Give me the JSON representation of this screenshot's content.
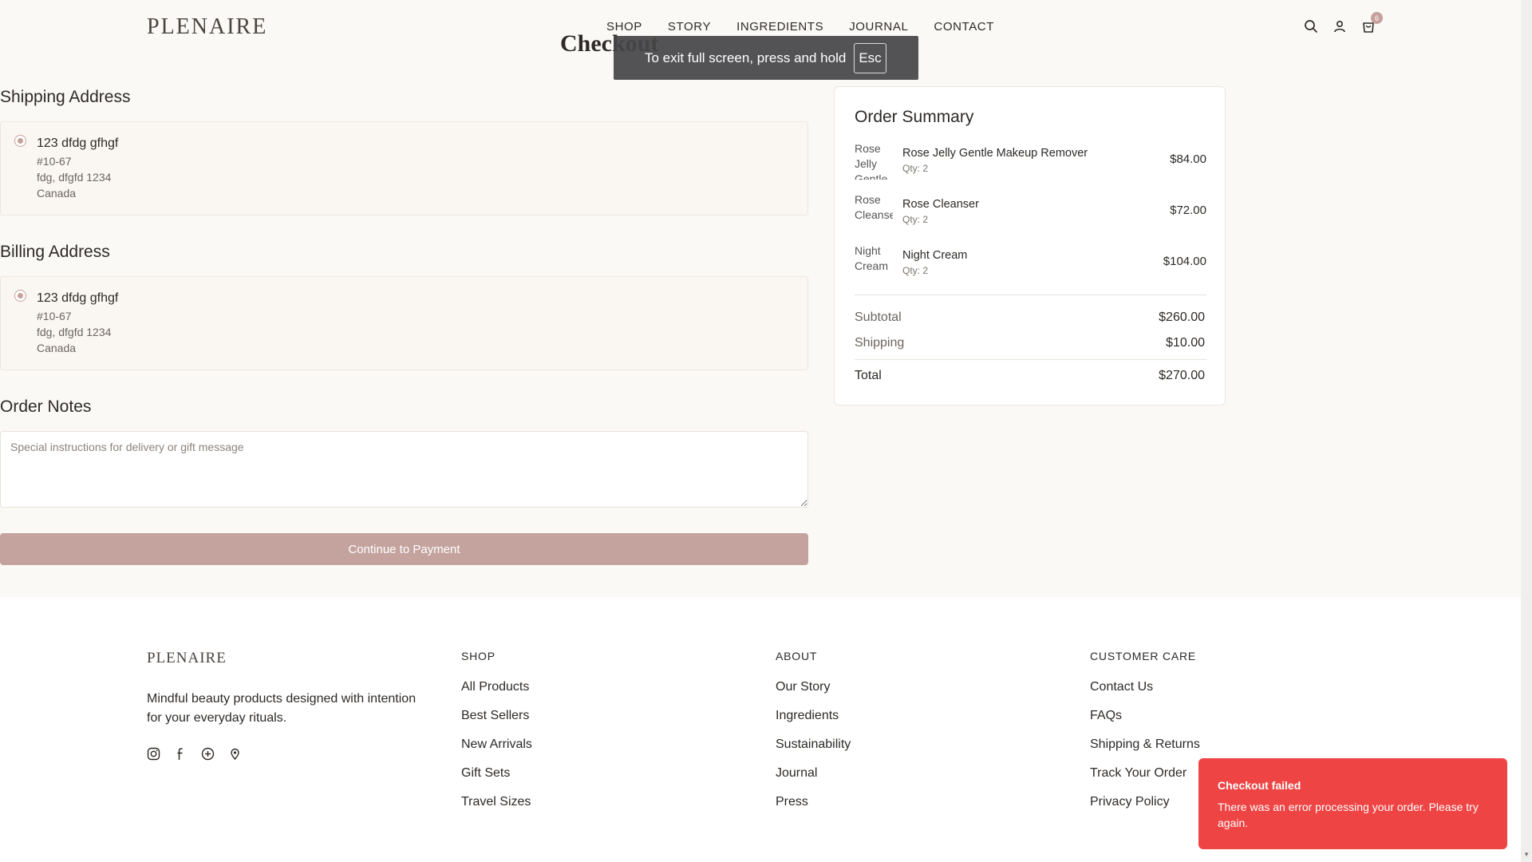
{
  "header": {
    "logo": "PLENAIRE",
    "nav": [
      "SHOP",
      "STORY",
      "INGREDIENTS",
      "JOURNAL",
      "CONTACT"
    ],
    "cart_count": "6",
    "icons": [
      "search-icon",
      "user-icon",
      "cart-icon"
    ]
  },
  "page_title": "Checkout",
  "fullscreen_notice": {
    "text": "To exit full screen, press and hold",
    "key": "Esc"
  },
  "shipping": {
    "title": "Shipping Address",
    "name": "123 dfdg gfhgf",
    "line1": "#10-67",
    "line2": "fdg, dfgfd 1234",
    "country": "Canada"
  },
  "billing": {
    "title": "Billing Address",
    "name": "123 dfdg gfhgf",
    "line1": "#10-67",
    "line2": "fdg, dfgfd 1234",
    "country": "Canada"
  },
  "notes": {
    "title": "Order Notes",
    "placeholder": "Special instructions for delivery or gift message",
    "value": ""
  },
  "continue_button": "Continue to Payment",
  "summary": {
    "title": "Order Summary",
    "items": [
      {
        "alt": "Rose Jelly Gentle Makeup Remover",
        "name": "Rose Jelly Gentle Makeup Remover",
        "qty": "Qty: 2",
        "price": "$84.00"
      },
      {
        "alt": "Rose Cleanser",
        "name": "Rose Cleanser",
        "qty": "Qty: 2",
        "price": "$72.00"
      },
      {
        "alt": "Night Cream",
        "name": "Night Cream",
        "qty": "Qty: 2",
        "price": "$104.00"
      }
    ],
    "subtotal_label": "Subtotal",
    "subtotal": "$260.00",
    "shipping_label": "Shipping",
    "shipping": "$10.00",
    "total_label": "Total",
    "total": "$270.00"
  },
  "footer": {
    "logo": "PLENAIRE",
    "tagline": "Mindful beauty products designed with intention for your everyday rituals.",
    "social_icons": [
      "instagram-icon",
      "facebook-icon",
      "pinterest-icon",
      "location-icon"
    ],
    "shop": {
      "title": "SHOP",
      "links": [
        "All Products",
        "Best Sellers",
        "New Arrivals",
        "Gift Sets",
        "Travel Sizes"
      ]
    },
    "about": {
      "title": "ABOUT",
      "links": [
        "Our Story",
        "Ingredients",
        "Sustainability",
        "Journal",
        "Press"
      ]
    },
    "care": {
      "title": "CUSTOMER CARE",
      "links": [
        "Contact Us",
        "FAQs",
        "Shipping & Returns",
        "Track Your Order",
        "Privacy Policy"
      ]
    }
  },
  "error_toast": {
    "title": "Checkout failed",
    "message": "There was an error processing your order. Please try again.",
    "color": "#ef4444"
  }
}
